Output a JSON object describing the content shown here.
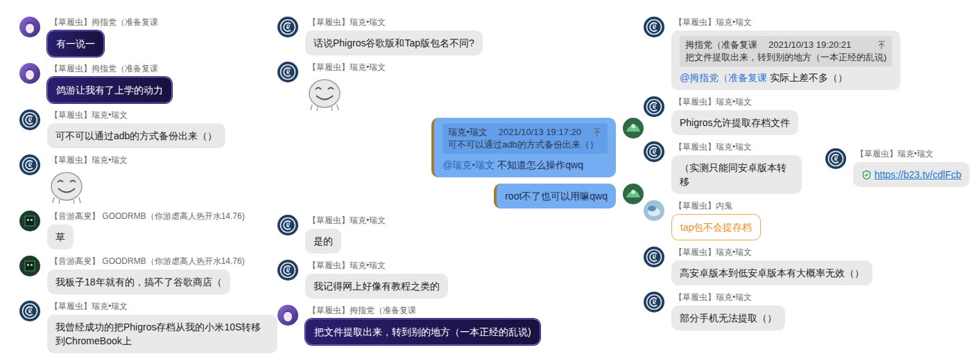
{
  "columns": [
    {
      "rows": [
        [
          {
            "sender": "【草履虫】拇指党（准备复课",
            "avatar": "muzhi",
            "side": "left",
            "kind": "purple",
            "text": "有一说一"
          }
        ],
        [
          {
            "sender": "【草履虫】拇指党（准备复课",
            "avatar": "muzhi",
            "side": "left",
            "kind": "purple",
            "text": "鸽游让我有了上学的动力"
          }
        ],
        [
          {
            "sender": "【草履虫】瑞克•瑞文",
            "avatar": "rick",
            "side": "left",
            "kind": "grey",
            "text": "可不可以通过adb的方式备份出来（）"
          }
        ],
        [
          {
            "sender": "【草履虫】瑞克•瑞文",
            "avatar": "rick",
            "side": "left",
            "kind": "sticker"
          }
        ],
        [
          {
            "sender": "【音游高叟】 GOODRMB（你游虐高人热开水14.76)",
            "avatar": "goodrmb",
            "side": "left",
            "kind": "grey",
            "text": "草"
          }
        ],
        [
          {
            "sender": "【音游高叟】 GOODRMB（你游虐高人热开水14.76)",
            "avatar": "goodrmb",
            "side": "left",
            "kind": "grey",
            "text": "我板子18年就有的，搞不了谷歌商店（"
          }
        ],
        [
          {
            "sender": "【草履虫】瑞克•瑞文",
            "avatar": "rick",
            "side": "left",
            "kind": "grey",
            "text": "我曾经成功的把Phigros存档从我的小米10S转移到ChromeBook上"
          }
        ]
      ]
    },
    {
      "rows": [
        [
          {
            "sender": "【草履虫】瑞克•瑞文",
            "avatar": "rick",
            "side": "left",
            "kind": "grey",
            "text": "话说Phigros谷歌版和Tap版包名不同?"
          }
        ],
        [
          {
            "sender": "【草履虫】瑞克•瑞文",
            "avatar": "rick",
            "side": "left",
            "kind": "sticker"
          }
        ],
        [
          {
            "avatar": "self",
            "side": "right",
            "kind": "blue",
            "quote": {
              "sender": "瑞克•瑞文",
              "time": "2021/10/13 19:17:20",
              "text": "可不可以通过adb的方式备份出来（）"
            },
            "mention": "@瑞克•瑞文",
            "text": "不知道怎么操作qwq"
          }
        ],
        [
          {
            "avatar": "self",
            "side": "right",
            "kind": "blue",
            "text": "root不了也可以用嘛qwq"
          }
        ],
        [
          {
            "sender": "【草履虫】瑞克•瑞文",
            "avatar": "rick",
            "side": "left",
            "kind": "grey",
            "text": "是的"
          }
        ],
        [
          {
            "sender": "【草履虫】瑞克•瑞文",
            "avatar": "rick",
            "side": "left",
            "kind": "grey",
            "text": "我记得网上好像有教程之类的"
          }
        ],
        [
          {
            "sender": "【草履虫】拇指党（准备复课",
            "avatar": "muzhi",
            "side": "left",
            "kind": "purple",
            "text": "把文件提取出来，转到别的地方（一本正经的乱说)"
          }
        ]
      ]
    },
    {
      "rows": [
        [
          {
            "sender": "【草履虫】瑞克•瑞文",
            "avatar": "rick",
            "side": "left",
            "kind": "grey",
            "quote": {
              "sender": "拇指党（准备复课",
              "time": "2021/10/13 19:20:21",
              "text": "把文件提取出来，转到别的地方（一本正经的乱说)"
            },
            "mention": "@拇指党（准备复课",
            "text": "实际上差不多（）"
          }
        ],
        [
          {
            "sender": "【草履虫】瑞克•瑞文",
            "avatar": "rick",
            "side": "left",
            "kind": "grey",
            "text": "Phigros允许提取存档文件"
          }
        ],
        [
          {
            "sender": "【草履虫】瑞克•瑞文",
            "avatar": "rick",
            "side": "left",
            "kind": "grey",
            "text": "（实测只能同安卓版本转移"
          },
          {
            "sender": "【草履虫】瑞克•瑞文",
            "avatar": "rick",
            "side": "left",
            "kind": "link",
            "text": "https://b23.tv/cdlFcb"
          }
        ],
        [
          {
            "sender": "【草履虫】内鬼",
            "avatar": "neigui",
            "side": "left",
            "kind": "orange",
            "text": "tap包不会提存档"
          }
        ],
        [
          {
            "sender": "【草履虫】瑞克•瑞文",
            "avatar": "rick",
            "side": "left",
            "kind": "grey",
            "text": "高安卓版本到低安卓版本有大概率无效（）"
          }
        ],
        [
          {
            "sender": "【草履虫】瑞克•瑞文",
            "avatar": "rick",
            "side": "left",
            "kind": "grey",
            "text": "部分手机无法提取（）"
          }
        ]
      ]
    }
  ]
}
